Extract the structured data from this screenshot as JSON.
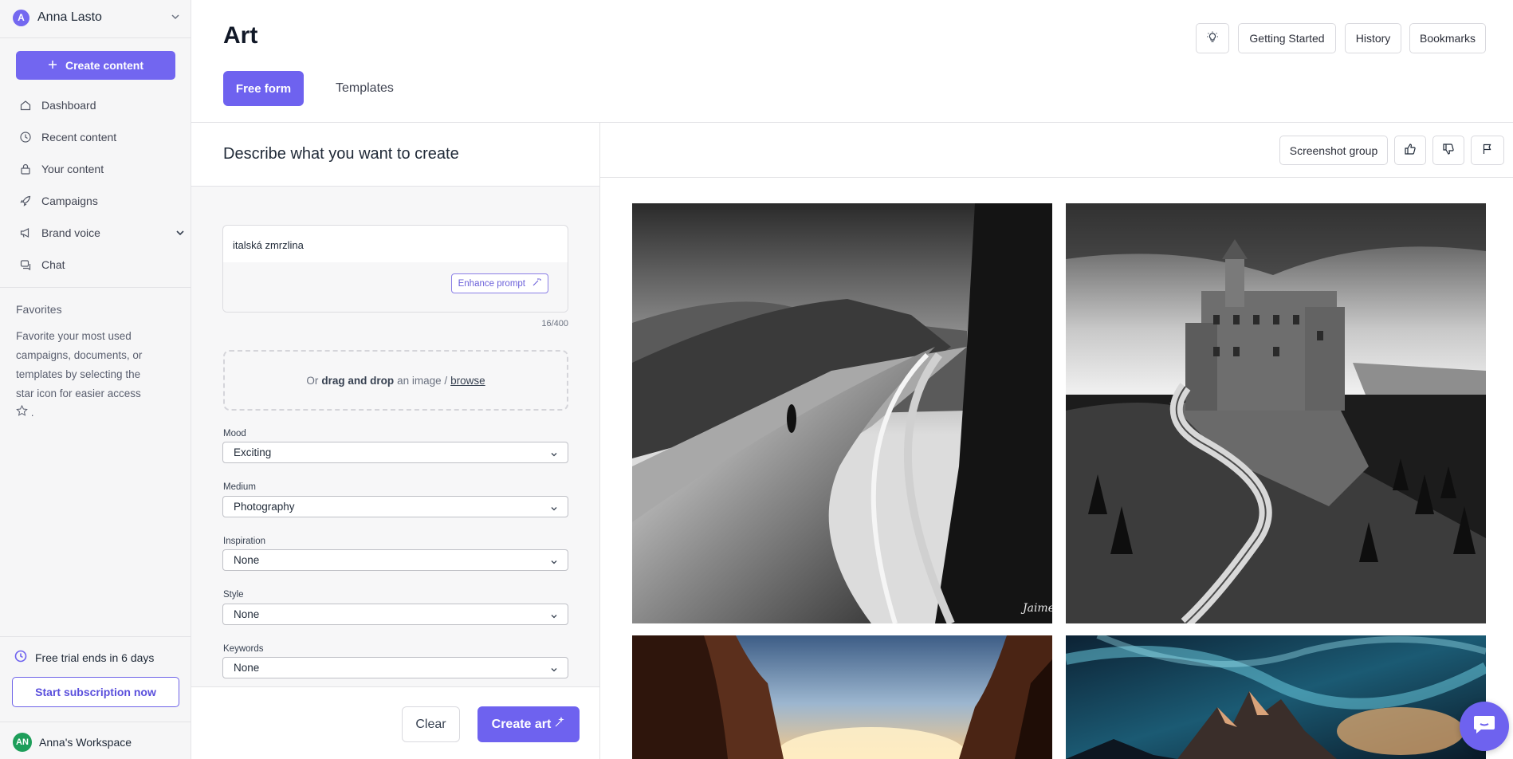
{
  "user": {
    "initial": "A",
    "name": "Anna Lasto"
  },
  "sidebar": {
    "create_label": "Create content",
    "items": [
      {
        "label": "Dashboard",
        "icon": "home-icon"
      },
      {
        "label": "Recent content",
        "icon": "clock-icon"
      },
      {
        "label": "Your content",
        "icon": "lock-icon"
      },
      {
        "label": "Campaigns",
        "icon": "rocket-icon"
      },
      {
        "label": "Brand voice",
        "icon": "megaphone-icon"
      },
      {
        "label": "Chat",
        "icon": "chat-icon"
      }
    ],
    "favorites_title": "Favorites",
    "favorites_text": "Favorite your most used campaigns, documents, or templates by selecting the star icon for easier access",
    "trial_text": "Free trial ends in 6 days",
    "subscribe_label": "Start subscription now",
    "workspace_initials": "AN",
    "workspace_name": "Anna's Workspace"
  },
  "header": {
    "title": "Art",
    "tabs": {
      "free_form": "Free form",
      "templates": "Templates"
    },
    "buttons": {
      "getting_started": "Getting Started",
      "history": "History",
      "bookmarks": "Bookmarks"
    }
  },
  "form": {
    "title": "Describe what you want to create",
    "prompt_value": "italská zmrzlina",
    "enhance_label": "Enhance prompt",
    "char_count": "16/400",
    "drop": {
      "prefix": "Or",
      "bold": "drag and drop",
      "middle": "an image /",
      "link": "browse"
    },
    "fields": [
      {
        "label": "Mood",
        "value": "Exciting"
      },
      {
        "label": "Medium",
        "value": "Photography"
      },
      {
        "label": "Inspiration",
        "value": "None"
      },
      {
        "label": "Style",
        "value": "None"
      },
      {
        "label": "Keywords",
        "value": "None"
      }
    ],
    "clear_label": "Clear",
    "create_label": "Create art"
  },
  "results": {
    "screenshot_group_label": "Screenshot group",
    "images": [
      {
        "description": "black and white mountain road",
        "signature": "Jaime"
      },
      {
        "description": "black and white castle on cliff with winding road"
      },
      {
        "description": "canyon at sunset"
      },
      {
        "description": "mountains under aurora"
      }
    ]
  },
  "colors": {
    "accent": "#6e62ef",
    "workspace_avatar": "#1e9e5a"
  }
}
